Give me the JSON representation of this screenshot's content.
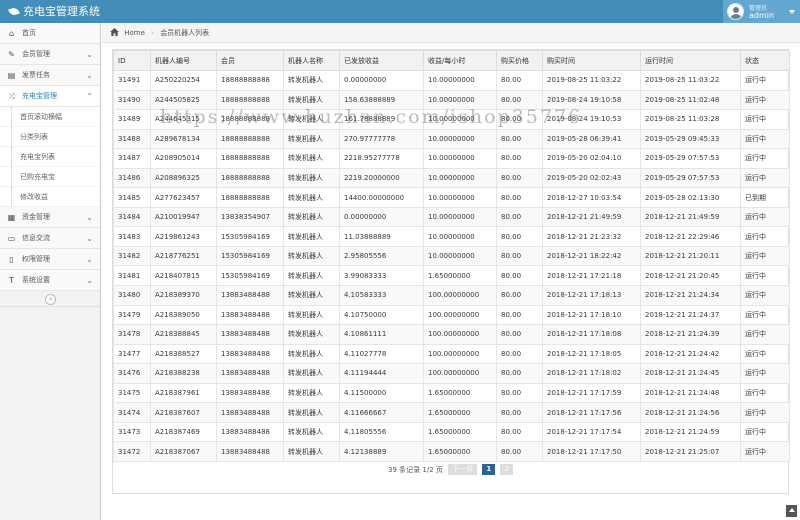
{
  "app": {
    "title": "充电宝管理系统"
  },
  "user": {
    "role": "管理员",
    "name": "admin"
  },
  "sidebar": {
    "items": [
      {
        "label": "首页",
        "icon": "tachometer-icon",
        "glyph": "⌂"
      },
      {
        "label": "会员管理",
        "icon": "pencil-square-icon",
        "glyph": "✎"
      },
      {
        "label": "发票任务",
        "icon": "list-alt-icon",
        "glyph": "▤"
      },
      {
        "label": "充电宝管理",
        "icon": "random-icon",
        "glyph": "⤨"
      },
      {
        "label": "资金管理",
        "icon": "calendar-icon",
        "glyph": "▦"
      },
      {
        "label": "信息交流",
        "icon": "comments-icon",
        "glyph": "▭"
      },
      {
        "label": "权限管理",
        "icon": "file-icon",
        "glyph": "▯"
      },
      {
        "label": "系统设置",
        "icon": "text-width-icon",
        "glyph": "T"
      }
    ],
    "sub_items": [
      {
        "label": "首页滚动横幅"
      },
      {
        "label": "分类列表"
      },
      {
        "label": "充电宝列表"
      },
      {
        "label": "已购充电宝"
      },
      {
        "label": "修改收益"
      }
    ]
  },
  "breadcrumb": {
    "home": "Home",
    "current": "会员机器人列表"
  },
  "table": {
    "headers": [
      "ID",
      "机器人编号",
      "会员",
      "机器人名称",
      "已发放收益",
      "收益/每小时",
      "购买价格",
      "购买时间",
      "运行时间",
      "状态"
    ],
    "rows": [
      [
        "31491",
        "A250220254",
        "18888888888",
        "转发机器人",
        "0.00000000",
        "10.00000000",
        "80.00",
        "2019-08-25 11:03:22",
        "2019-08-25 11:03:22",
        "运行中"
      ],
      [
        "31490",
        "A244505825",
        "18888888888",
        "转发机器人",
        "158.63888889",
        "10.00000000",
        "80.00",
        "2019-08-24 19:10:58",
        "2019-08-25 11:02:48",
        "运行中"
      ],
      [
        "31489",
        "A244645315",
        "18888888888",
        "转发机器人",
        "161.78888889",
        "10.00000000",
        "80.00",
        "2019-08-24 19:10:53",
        "2019-08-25 11:03:28",
        "运行中"
      ],
      [
        "31488",
        "A289678134",
        "18888888888",
        "转发机器人",
        "270.97777778",
        "10.00000000",
        "80.00",
        "2019-05-28 06:39:41",
        "2019-05-29 09:45:33",
        "运行中"
      ],
      [
        "31487",
        "A208905014",
        "18888888888",
        "转发机器人",
        "2218.95277778",
        "10.00000000",
        "80.00",
        "2019-05-20 02:04:10",
        "2019-05-29 07:57:53",
        "运行中"
      ],
      [
        "31486",
        "A208896325",
        "18888888888",
        "转发机器人",
        "2219.20000000",
        "10.00000000",
        "80.00",
        "2019-05-20 02:02:43",
        "2019-05-29 07:57:53",
        "运行中"
      ],
      [
        "31485",
        "A277623457",
        "18888888888",
        "转发机器人",
        "14400.00000000",
        "10.00000000",
        "80.00",
        "2018-12-27 10:03:54",
        "2019-05-28 02:13:30",
        "已到期"
      ],
      [
        "31484",
        "A210019947",
        "13838354907",
        "转发机器人",
        "0.00000000",
        "10.00000000",
        "80.00",
        "2018-12-21 21:49:59",
        "2018-12-21 21:49:59",
        "运行中"
      ],
      [
        "31483",
        "A219861243",
        "15305984169",
        "转发机器人",
        "11.03888889",
        "10.00000000",
        "80.00",
        "2018-12-21 21:23:32",
        "2018-12-21 22:29:46",
        "运行中"
      ],
      [
        "31482",
        "A218776251",
        "15305984169",
        "转发机器人",
        "2.95805556",
        "10.00000000",
        "80.00",
        "2018-12-21 18:22:42",
        "2018-12-21 21:20:11",
        "运行中"
      ],
      [
        "31481",
        "A218407815",
        "15305984169",
        "转发机器人",
        "3.99083333",
        "1.65000000",
        "80.00",
        "2018-12-21 17:21:18",
        "2018-12-21 21:20:45",
        "运行中"
      ],
      [
        "31480",
        "A218389370",
        "13883488488",
        "转发机器人",
        "4.10583333",
        "100.00000000",
        "80.00",
        "2018-12-21 17:18:13",
        "2018-12-21 21:24:34",
        "运行中"
      ],
      [
        "31479",
        "A218389050",
        "13883488488",
        "转发机器人",
        "4.10750000",
        "100.00000000",
        "80.00",
        "2018-12-21 17:18:10",
        "2018-12-21 21:24:37",
        "运行中"
      ],
      [
        "31478",
        "A218388845",
        "13883488488",
        "转发机器人",
        "4.10861111",
        "100.00000000",
        "80.00",
        "2018-12-21 17:18:08",
        "2018-12-21 21:24:39",
        "运行中"
      ],
      [
        "31477",
        "A218388527",
        "13883488488",
        "转发机器人",
        "4.11027778",
        "100.00000000",
        "80.00",
        "2018-12-21 17:18:05",
        "2018-12-21 21:24:42",
        "运行中"
      ],
      [
        "31476",
        "A218388238",
        "13883488488",
        "转发机器人",
        "4.11194444",
        "100.00000000",
        "80.00",
        "2018-12-21 17:18:02",
        "2018-12-21 21:24:45",
        "运行中"
      ],
      [
        "31475",
        "A218387961",
        "13883488488",
        "转发机器人",
        "4.11500000",
        "1.65000000",
        "80.00",
        "2018-12-21 17:17:59",
        "2018-12-21 21:24:48",
        "运行中"
      ],
      [
        "31474",
        "A218387607",
        "13883488488",
        "转发机器人",
        "4.11666667",
        "1.65000000",
        "80.00",
        "2018-12-21 17:17:56",
        "2018-12-21 21:24:56",
        "运行中"
      ],
      [
        "31473",
        "A218387469",
        "13883488488",
        "转发机器人",
        "4.11805556",
        "1.65000000",
        "80.00",
        "2018-12-21 17:17:54",
        "2018-12-21 21:24:59",
        "运行中"
      ],
      [
        "31472",
        "A218387067",
        "13883488488",
        "转发机器人",
        "4.12138889",
        "1.65000000",
        "80.00",
        "2018-12-21 17:17:50",
        "2018-12-21 21:25:07",
        "运行中"
      ]
    ]
  },
  "pager": {
    "summary": "39 条记录 1/2 页",
    "next": "下一页",
    "current_page": "1",
    "page2": "2"
  },
  "watermark": "https://www.huzhan.com/ishop35776",
  "colors": {
    "header_bg": "#438eb9",
    "user_bg": "#62a8d1",
    "active_nav": "#2b7dbc",
    "pager_active": "#2a6496"
  }
}
